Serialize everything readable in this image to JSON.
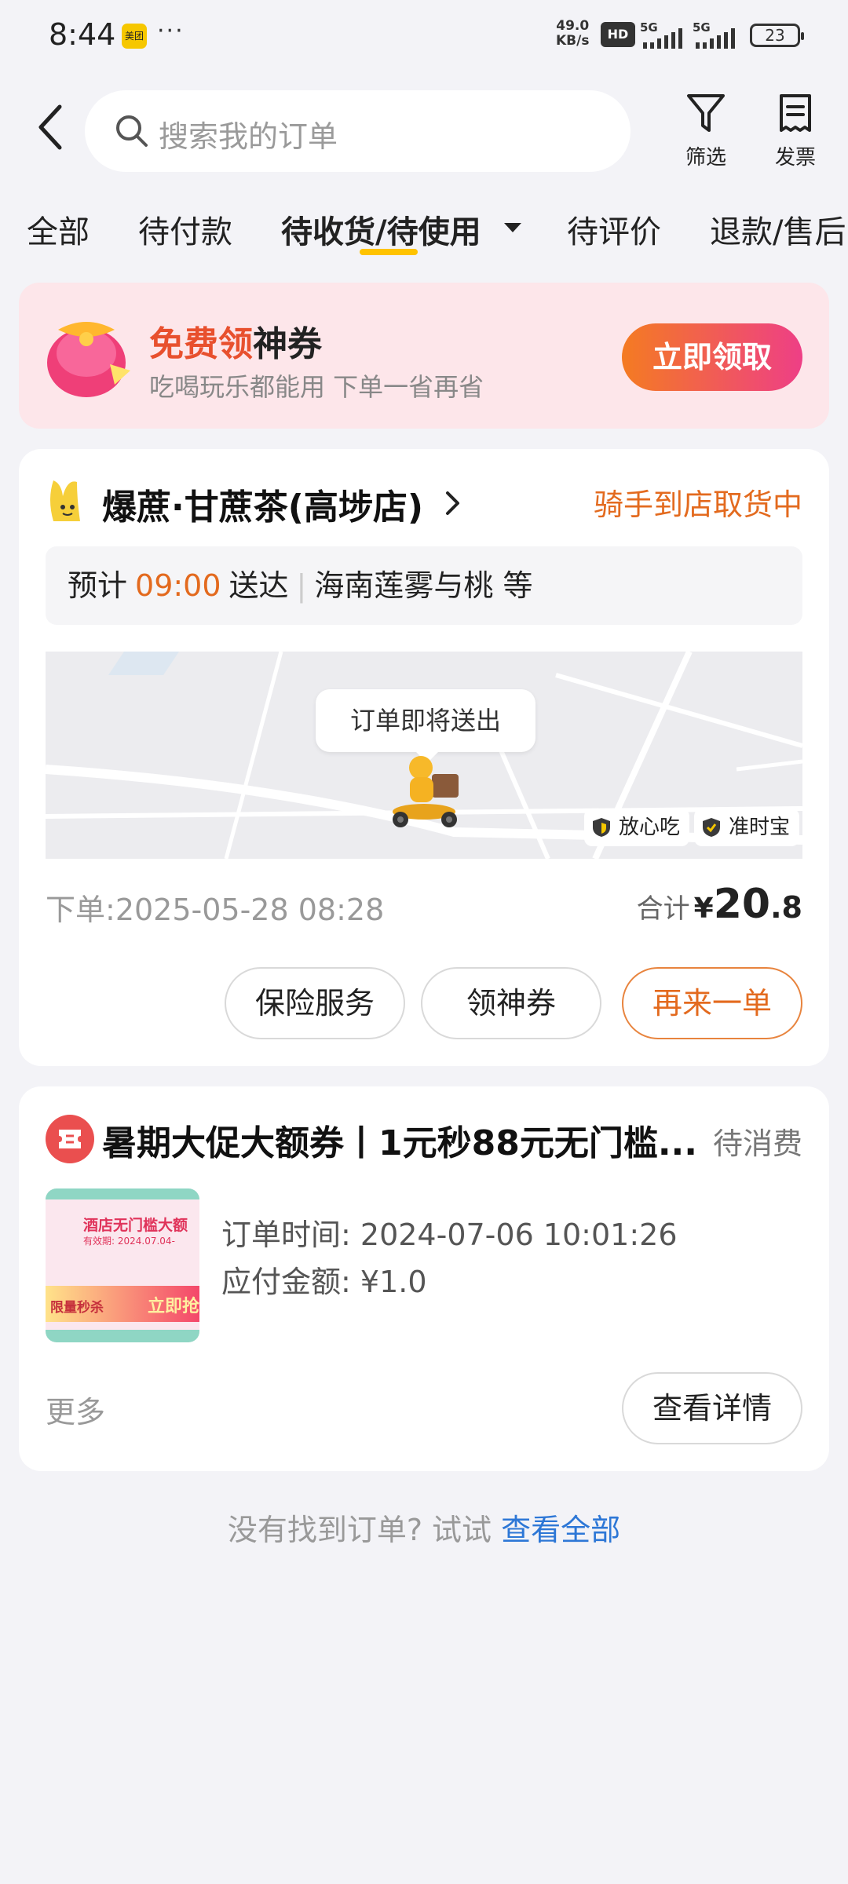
{
  "status_bar": {
    "time": "8:44",
    "app_icon_text": "美团",
    "more": "···",
    "net_speed_value": "49.0",
    "net_speed_unit": "KB/s",
    "hd": "HD",
    "signal1": "5G",
    "signal2": "5G",
    "battery": "23"
  },
  "header": {
    "search_placeholder": "搜索我的订单",
    "filter_label": "筛选",
    "invoice_label": "发票"
  },
  "tabs": [
    {
      "label": "全部"
    },
    {
      "label": "待付款"
    },
    {
      "label": "待收货/待使用"
    },
    {
      "label": "待评价"
    },
    {
      "label": "退款/售后"
    }
  ],
  "promo": {
    "title_highlight": "免费领",
    "title_rest": "神券",
    "subtitle": "吃喝玩乐都能用 下单一省再省",
    "button": "立即领取",
    "colors": {
      "button_start": "#f47b22",
      "button_end": "#ee3f86"
    }
  },
  "order1": {
    "shop_name": "爆蔗·甘蔗茶(高埗店)",
    "status": "骑手到店取货中",
    "eta_prefix": "预计",
    "eta_time": "09:00",
    "eta_suffix": "送达",
    "items": "海南莲雾与桃 等",
    "map_bubble": "订单即将送出",
    "tag1": "放心吃",
    "tag2": "准时宝",
    "order_date_label": "下单:",
    "order_date": "2025-05-28 08:28",
    "total_label": "合计",
    "total_symbol": "¥",
    "total_int": "20",
    "total_dec": ".8",
    "buttons": [
      "保险服务",
      "领神券",
      "再来一单"
    ],
    "accent_color": "#e36a1e"
  },
  "order2": {
    "title": "暑期大促大额券丨1元秒88元无门槛...",
    "status": "待消费",
    "thumb_title": "酒店无门槛大额",
    "thumb_validity": "有效期: 2024.07.04-",
    "thumb_tag": "限量秒杀",
    "thumb_btn": "立即抢",
    "order_time_label": "订单时间:",
    "order_time": "2024-07-06 10:01:26",
    "amount_label": "应付金额:",
    "amount": "¥1.0",
    "more": "更多",
    "detail_button": "查看详情"
  },
  "footer": {
    "hint": "没有找到订单? 试试",
    "link": "查看全部"
  }
}
